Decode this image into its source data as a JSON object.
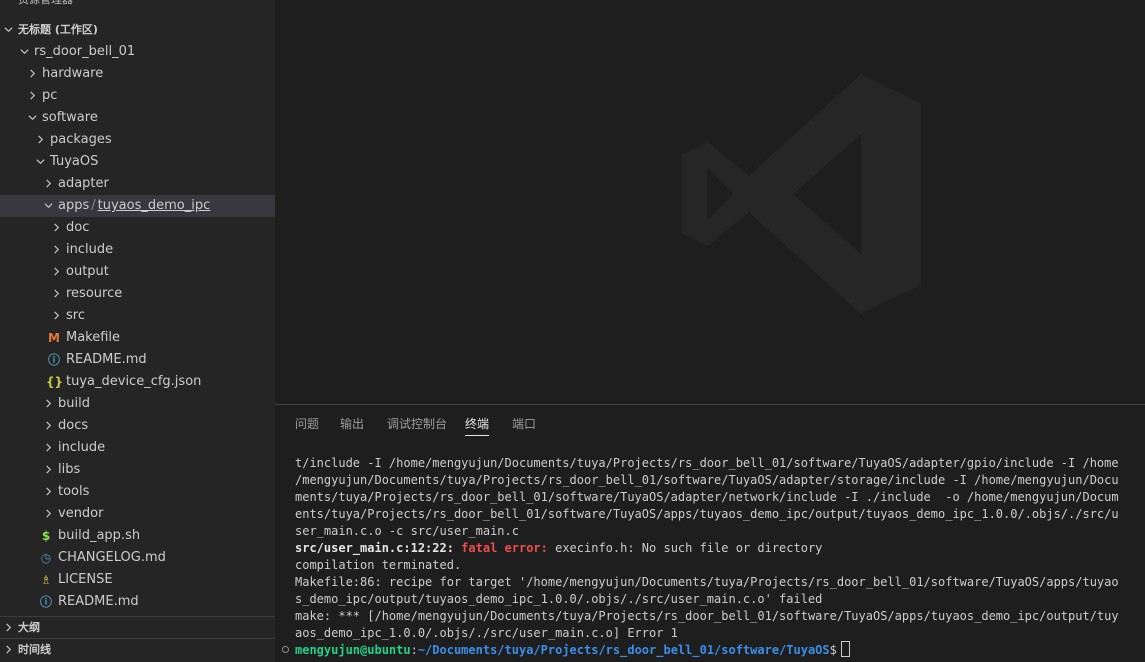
{
  "explorer": {
    "title": "资源管理器",
    "more": "···"
  },
  "tree": [
    {
      "label": "无标题 (工作区)",
      "indent": 0,
      "kind": "section",
      "chev": "down"
    },
    {
      "label": "rs_door_bell_01",
      "indent": 1,
      "kind": "folder",
      "chev": "down"
    },
    {
      "label": "hardware",
      "indent": 2,
      "kind": "folder",
      "chev": "right"
    },
    {
      "label": "pc",
      "indent": 2,
      "kind": "folder",
      "chev": "right"
    },
    {
      "label": "software",
      "indent": 2,
      "kind": "folder",
      "chev": "down"
    },
    {
      "label": "packages",
      "indent": 3,
      "kind": "folder",
      "chev": "right"
    },
    {
      "label": "TuyaOS",
      "indent": 3,
      "kind": "folder",
      "chev": "down"
    },
    {
      "label": "adapter",
      "indent": 4,
      "kind": "folder",
      "chev": "right"
    },
    {
      "label": "apps",
      "label2": "tuyaos_demo_ipc",
      "sep": "/",
      "indent": 4,
      "kind": "folder",
      "chev": "down",
      "selected": true
    },
    {
      "label": "doc",
      "indent": 5,
      "kind": "folder",
      "chev": "right"
    },
    {
      "label": "include",
      "indent": 5,
      "kind": "folder",
      "chev": "right"
    },
    {
      "label": "output",
      "indent": 5,
      "kind": "folder",
      "chev": "right"
    },
    {
      "label": "resource",
      "indent": 5,
      "kind": "folder",
      "chev": "right"
    },
    {
      "label": "src",
      "indent": 5,
      "kind": "folder",
      "chev": "right"
    },
    {
      "label": "Makefile",
      "indent": 5,
      "kind": "file",
      "icon": "makefile-icon",
      "glyph": "M",
      "color": "#e37933"
    },
    {
      "label": "README.md",
      "indent": 5,
      "kind": "file",
      "icon": "info-icon",
      "glyph": "ⓘ",
      "color": "#519aba"
    },
    {
      "label": "tuya_device_cfg.json",
      "indent": 5,
      "kind": "file",
      "icon": "json-icon",
      "glyph": "{}",
      "color": "#cbcb41"
    },
    {
      "label": "build",
      "indent": 4,
      "kind": "folder",
      "chev": "right"
    },
    {
      "label": "docs",
      "indent": 4,
      "kind": "folder",
      "chev": "right"
    },
    {
      "label": "include",
      "indent": 4,
      "kind": "folder",
      "chev": "right"
    },
    {
      "label": "libs",
      "indent": 4,
      "kind": "folder",
      "chev": "right"
    },
    {
      "label": "tools",
      "indent": 4,
      "kind": "folder",
      "chev": "right"
    },
    {
      "label": "vendor",
      "indent": 4,
      "kind": "folder",
      "chev": "right"
    },
    {
      "label": "build_app.sh",
      "indent": 4,
      "kind": "file",
      "icon": "shell-icon",
      "glyph": "$",
      "color": "#89e051"
    },
    {
      "label": "CHANGELOG.md",
      "indent": 4,
      "kind": "file",
      "icon": "changelog-icon",
      "glyph": "◷",
      "color": "#519aba"
    },
    {
      "label": "LICENSE",
      "indent": 4,
      "kind": "file",
      "icon": "license-icon",
      "glyph": "♗",
      "color": "#cbcb41"
    },
    {
      "label": "README.md",
      "indent": 4,
      "kind": "file",
      "icon": "info-icon",
      "glyph": "ⓘ",
      "color": "#519aba"
    },
    {
      "label": "大纲",
      "indent": 0,
      "kind": "section",
      "chev": "right"
    },
    {
      "label": "时间线",
      "indent": 0,
      "kind": "section",
      "chev": "right"
    }
  ],
  "panel": {
    "tabs": [
      {
        "label": "问题",
        "active": false
      },
      {
        "label": "输出",
        "active": false
      },
      {
        "label": "调试控制台",
        "active": false
      },
      {
        "label": "终端",
        "active": true
      },
      {
        "label": "端口",
        "active": false
      }
    ]
  },
  "terminal": {
    "lines": [
      [
        {
          "t": "t/include -I /home/mengyujun/Documents/tuya/Projects/rs_door_bell_01/software/TuyaOS/adapter/gpio/include -I /home"
        }
      ],
      [
        {
          "t": "/mengyujun/Documents/tuya/Projects/rs_door_bell_01/software/TuyaOS/adapter/storage/include -I /home/mengyujun/Docu"
        }
      ],
      [
        {
          "t": "ments/tuya/Projects/rs_door_bell_01/software/TuyaOS/adapter/network/include -I ./include  -o /home/mengyujun/Docum"
        }
      ],
      [
        {
          "t": "ents/tuya/Projects/rs_door_bell_01/software/TuyaOS/apps/tuyaos_demo_ipc/output/tuyaos_demo_ipc_1.0.0/.objs/./src/u"
        }
      ],
      [
        {
          "t": "ser_main.c.o -c src/user_main.c"
        }
      ],
      [
        {
          "t": "src/user_main.c:12:22: ",
          "c": "bold-white"
        },
        {
          "t": "fatal error: ",
          "c": "err-red"
        },
        {
          "t": "execinfo.h: No such file or directory"
        }
      ],
      [
        {
          "t": "compilation terminated."
        }
      ],
      [
        {
          "t": "Makefile:86: recipe for target '/home/mengyujun/Documents/tuya/Projects/rs_door_bell_01/software/TuyaOS/apps/tuyao"
        }
      ],
      [
        {
          "t": "s_demo_ipc/output/tuyaos_demo_ipc_1.0.0/.objs/./src/user_main.c.o' failed"
        }
      ],
      [
        {
          "t": "make: *** [/home/mengyujun/Documents/tuya/Projects/rs_door_bell_01/software/TuyaOS/apps/tuyaos_demo_ipc/output/tuy"
        }
      ],
      [
        {
          "t": "aos_demo_ipc_1.0.0/.objs/./src/user_main.c.o] Error 1"
        }
      ]
    ],
    "prompt": {
      "user": "mengyujun@ubuntu",
      "colon": ":",
      "path": "~/Documents/tuya/Projects/rs_door_bell_01/software/TuyaOS",
      "symbol": "$"
    }
  },
  "colors": {
    "sidebar_bg": "#252526",
    "editor_bg": "#1e1e1e",
    "selected_row": "#37373d",
    "error_red": "#f14c4c",
    "prompt_green": "#23d18b",
    "prompt_blue": "#3b8eea"
  }
}
